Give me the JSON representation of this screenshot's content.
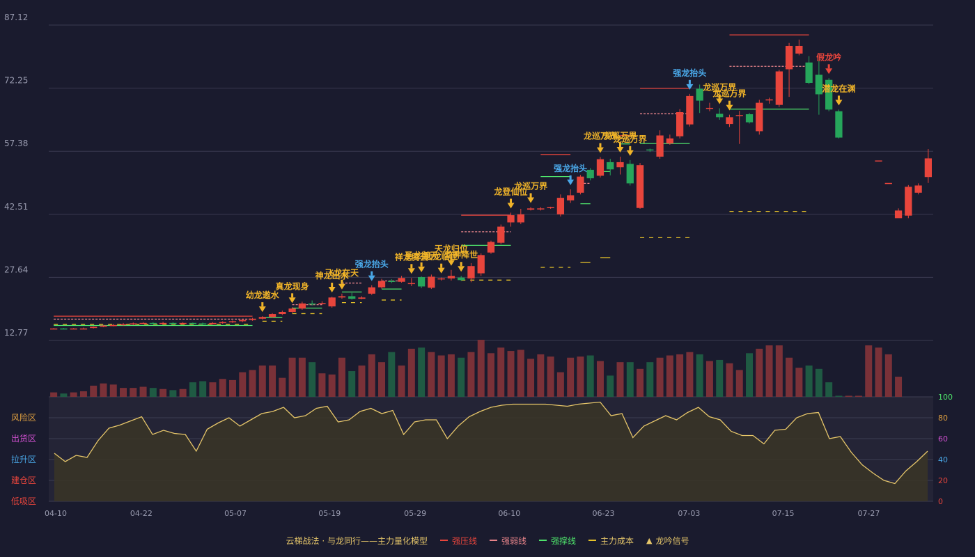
{
  "chart_data": {
    "type": "candlestick",
    "price_axis": {
      "ticks": [
        "87.12",
        "72.25",
        "57.38",
        "42.51",
        "27.64",
        "12.77"
      ],
      "ylim": [
        12.77,
        87.12
      ]
    },
    "dates": [
      "04-10",
      "04-22",
      "05-07",
      "05-19",
      "05-29",
      "06-10",
      "06-23",
      "07-03",
      "07-15",
      "07-27"
    ],
    "colors": {
      "up": "#e8453c",
      "down": "#26a65b",
      "vol_up": "#7a3138",
      "vol_down": "#1f5a43",
      "signal": "#f0b429",
      "signal_blue": "#4aa8e8",
      "signal_red": "#e8453c",
      "line": "#e6c66a",
      "grid": "#3a3b50"
    },
    "candles": [
      [
        15.5,
        15.6,
        15.4,
        15.7
      ],
      [
        15.6,
        15.5,
        15.4,
        15.7
      ],
      [
        15.5,
        15.6,
        15.4,
        15.7
      ],
      [
        15.6,
        15.6,
        15.5,
        15.8
      ],
      [
        15.7,
        16.0,
        15.6,
        16.1
      ],
      [
        16.0,
        16.3,
        15.9,
        16.4
      ],
      [
        16.3,
        16.4,
        16.1,
        16.7
      ],
      [
        16.4,
        16.6,
        16.2,
        16.9
      ],
      [
        16.6,
        16.8,
        16.4,
        17.0
      ],
      [
        16.8,
        16.9,
        16.6,
        17.1
      ],
      [
        16.9,
        16.8,
        16.6,
        17.1
      ],
      [
        16.8,
        16.9,
        16.6,
        17.2
      ],
      [
        16.9,
        16.8,
        16.6,
        17.1
      ],
      [
        16.8,
        16.9,
        16.6,
        17.1
      ],
      [
        16.9,
        16.8,
        16.6,
        17.0
      ],
      [
        16.8,
        16.6,
        16.4,
        17.0
      ],
      [
        16.6,
        16.9,
        16.5,
        17.1
      ],
      [
        16.9,
        17.1,
        16.7,
        17.3
      ],
      [
        17.1,
        17.3,
        16.9,
        17.5
      ],
      [
        17.3,
        17.6,
        17.1,
        17.8
      ],
      [
        17.6,
        17.9,
        17.4,
        18.1
      ],
      [
        17.9,
        18.3,
        17.7,
        18.5
      ],
      [
        18.3,
        19.0,
        18.1,
        19.2
      ],
      [
        19.0,
        19.5,
        18.8,
        19.8
      ],
      [
        19.5,
        20.3,
        19.3,
        20.6
      ],
      [
        20.3,
        21.5,
        20.0,
        21.9
      ],
      [
        21.5,
        21.4,
        21.0,
        22.2
      ],
      [
        21.4,
        21.6,
        21.2,
        22.0
      ],
      [
        20.8,
        22.9,
        20.5,
        23.1
      ],
      [
        22.9,
        23.2,
        22.6,
        23.8
      ],
      [
        23.2,
        22.6,
        22.4,
        24.0
      ],
      [
        22.6,
        22.9,
        22.5,
        23.2
      ],
      [
        23.8,
        25.3,
        23.5,
        25.8
      ],
      [
        25.3,
        26.8,
        25.0,
        27.3
      ],
      [
        26.8,
        26.6,
        26.3,
        27.2
      ],
      [
        26.6,
        27.5,
        26.4,
        28.0
      ],
      [
        26.1,
        26.3,
        25.6,
        27.5
      ],
      [
        27.7,
        25.5,
        25.1,
        27.9
      ],
      [
        25.2,
        27.8,
        24.9,
        28.3
      ],
      [
        27.3,
        27.4,
        26.9,
        27.6
      ],
      [
        27.4,
        28.0,
        26.9,
        29.4
      ],
      [
        27.6,
        27.0,
        26.8,
        28.0
      ],
      [
        27.4,
        30.3,
        26.5,
        31.0
      ],
      [
        28.6,
        32.9,
        28.0,
        33.3
      ],
      [
        33.5,
        36.0,
        33.2,
        36.3
      ],
      [
        35.8,
        39.6,
        35.5,
        40.1
      ],
      [
        40.6,
        42.3,
        39.6,
        42.9
      ],
      [
        40.6,
        42.5,
        40.2,
        43.8
      ],
      [
        43.6,
        43.9,
        43.4,
        44.2
      ],
      [
        43.7,
        43.9,
        43.4,
        44.2
      ],
      [
        44.0,
        44.2,
        43.8,
        44.3
      ],
      [
        42.5,
        46.4,
        42.0,
        47.2
      ],
      [
        45.8,
        47.0,
        45.2,
        48.4
      ],
      [
        47.6,
        51.4,
        47.2,
        51.8
      ],
      [
        53.0,
        51.0,
        50.5,
        53.4
      ],
      [
        51.6,
        55.5,
        51.2,
        56.0
      ],
      [
        54.8,
        53.1,
        51.7,
        55.6
      ],
      [
        53.6,
        54.8,
        51.9,
        56.1
      ],
      [
        54.4,
        49.8,
        49.3,
        55.3
      ],
      [
        44.0,
        54.1,
        43.8,
        54.6
      ],
      [
        57.8,
        57.7,
        57.2,
        58.0
      ],
      [
        56.1,
        61.1,
        55.6,
        62.3
      ],
      [
        59.2,
        60.4,
        58.9,
        61.3
      ],
      [
        60.9,
        66.6,
        60.4,
        67.3
      ],
      [
        63.7,
        70.4,
        63.2,
        70.9
      ],
      [
        72.1,
        69.3,
        66.4,
        73.1
      ],
      [
        67.4,
        67.6,
        66.8,
        68.8
      ],
      [
        66.2,
        65.4,
        64.8,
        67.5
      ],
      [
        63.8,
        65.4,
        63.1,
        66.0
      ],
      [
        65.7,
        65.9,
        59.1,
        66.9
      ],
      [
        66.1,
        64.2,
        63.9,
        66.4
      ],
      [
        62.1,
        68.8,
        61.3,
        69.5
      ],
      [
        69.4,
        69.6,
        68.6,
        70.0
      ],
      [
        68.3,
        76.2,
        67.8,
        76.6
      ],
      [
        76.7,
        82.2,
        70.2,
        82.9
      ],
      [
        80.4,
        82.2,
        80.0,
        83.7
      ],
      [
        78.3,
        73.5,
        73.2,
        79.8
      ],
      [
        75.4,
        70.8,
        66.0,
        78.8
      ],
      [
        74.2,
        67.2,
        66.8,
        74.6
      ],
      [
        66.8,
        60.6,
        60.4,
        67.2
      ],
      null,
      null,
      null,
      [
        55.2,
        55.2,
        55.2,
        55.2
      ],
      [
        49.9,
        49.9,
        49.9,
        49.9
      ],
      [
        41.6,
        43.4,
        43.2,
        43.9
      ],
      [
        42.2,
        49.0,
        41.6,
        49.4
      ],
      [
        47.6,
        49.3,
        47.2,
        49.8
      ],
      [
        51.3,
        55.7,
        49.9,
        57.9
      ]
    ],
    "volume": [
      4,
      3,
      4,
      5,
      10,
      12,
      11,
      8,
      8,
      9,
      8,
      7,
      6,
      7,
      13,
      14,
      13,
      16,
      15,
      22,
      24,
      28,
      28,
      17,
      35,
      35,
      31,
      21,
      20,
      35,
      23,
      28,
      38,
      31,
      40,
      28,
      43,
      44,
      40,
      37,
      38,
      35,
      40,
      51,
      39,
      44,
      41,
      42,
      34,
      38,
      36,
      22,
      35,
      36,
      37,
      32,
      19,
      31,
      31,
      25,
      31,
      35,
      37,
      38,
      40,
      38,
      32,
      33,
      30,
      24,
      39,
      43,
      46,
      46,
      35,
      26,
      28,
      25,
      13,
      1,
      1,
      1,
      46,
      44,
      38,
      18
    ],
    "indicator": {
      "axis_ticks": [
        "100",
        "80",
        "60",
        "40",
        "20",
        "0"
      ],
      "zones": [
        "风险区",
        "出货区",
        "拉升区",
        "建仓区",
        "低吸区"
      ],
      "values": [
        46,
        38,
        44,
        42,
        58,
        70,
        73,
        77,
        81,
        64,
        68,
        65,
        64,
        48,
        69,
        75,
        80,
        72,
        78,
        84,
        86,
        90,
        80,
        82,
        89,
        91,
        76,
        78,
        86,
        89,
        84,
        87,
        64,
        76,
        78,
        78,
        60,
        72,
        81,
        86,
        90,
        92,
        93,
        93,
        93,
        93,
        92,
        91,
        93,
        94,
        95,
        82,
        84,
        61,
        72,
        77,
        82,
        78,
        85,
        90,
        81,
        78,
        67,
        63,
        63,
        55,
        68,
        69,
        80,
        84,
        85,
        60,
        62,
        47,
        35,
        27,
        20,
        17,
        29,
        38,
        48
      ]
    },
    "signals": [
      {
        "i": 21,
        "text": "幼龙遨水",
        "color": "signal"
      },
      {
        "i": 24,
        "text": "真龙现身",
        "color": "signal"
      },
      {
        "i": 28,
        "text": "神龙出水",
        "color": "signal"
      },
      {
        "i": 29,
        "text": "飞龙在天",
        "color": "signal"
      },
      {
        "i": 32,
        "text": "强龙抬头",
        "color": "signal_blue"
      },
      {
        "i": 36,
        "text": "祥龙腾云",
        "color": "signal"
      },
      {
        "i": 37,
        "text": "圣龙御天",
        "color": "signal"
      },
      {
        "i": 39,
        "text": "仙龙临世",
        "color": "signal"
      },
      {
        "i": 40,
        "text": "天龙归位",
        "color": "signal"
      },
      {
        "i": 41,
        "text": "龙神降世",
        "color": "signal"
      },
      {
        "i": 46,
        "text": "龙登仙位",
        "color": "signal"
      },
      {
        "i": 48,
        "text": "龙巡万界",
        "color": "signal"
      },
      {
        "i": 52,
        "text": "强龙抬头",
        "color": "signal_blue"
      },
      {
        "i": 55,
        "text": "龙巡万界",
        "color": "signal"
      },
      {
        "i": 57,
        "text": "龙巡万界",
        "color": "signal"
      },
      {
        "i": 58,
        "text": "龙巡万界",
        "color": "signal"
      },
      {
        "i": 64,
        "text": "强龙抬头",
        "color": "signal_blue"
      },
      {
        "i": 67,
        "text": "龙巡万界",
        "color": "signal"
      },
      {
        "i": 68,
        "text": "龙巡万界",
        "color": "signal"
      },
      {
        "i": 78,
        "text": "假龙吟",
        "color": "signal_red"
      },
      {
        "i": 79,
        "text": "潜龙在渊",
        "color": "signal"
      },
      {
        "i": 80,
        "text": "幼龙遨水",
        "color": "signal"
      }
    ]
  },
  "legend": {
    "title": "云梯战法 · 与龙同行——主力量化模型",
    "items": [
      {
        "label": "强压线",
        "color": "#e8453c"
      },
      {
        "label": "强弱线",
        "color": "#e8848a"
      },
      {
        "label": "强撑线",
        "color": "#4ee36b"
      },
      {
        "label": "主力成本",
        "color": "#e6c229"
      },
      {
        "label": "龙吟信号",
        "color": "#e6c66a"
      }
    ]
  }
}
